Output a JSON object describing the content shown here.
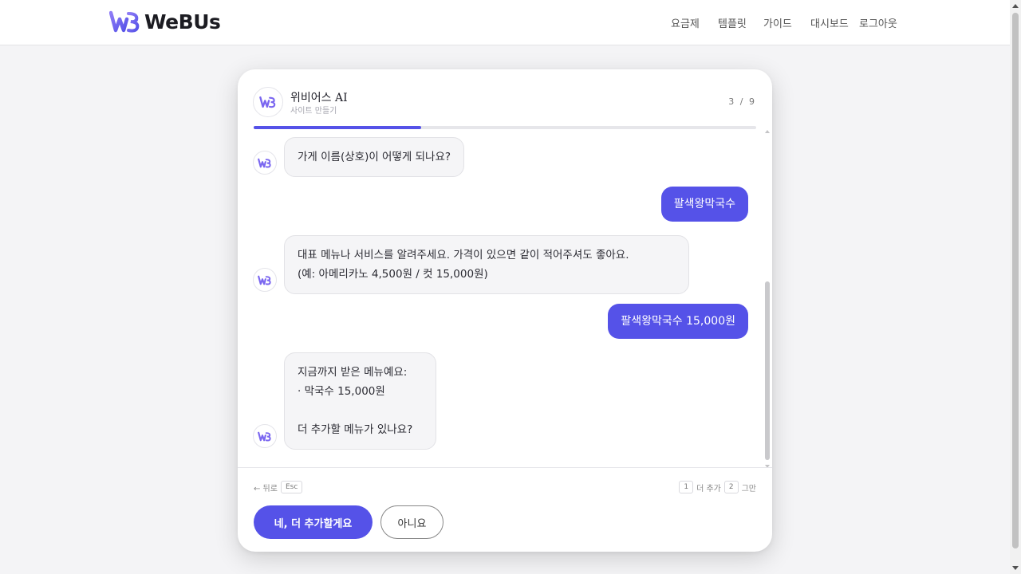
{
  "app": {
    "brand": "WeBUs",
    "brand_color": "#5552e8"
  },
  "nav": {
    "pricing": "요금제",
    "templates": "템플릿",
    "guide": "가이드",
    "dashboard": "대시보드",
    "logout": "로그아웃"
  },
  "chat": {
    "title": "위비어스 AI",
    "subtitle": "사이트 만들기",
    "step": "3 / 9",
    "progress": 0.333,
    "messages": [
      {
        "role": "bot",
        "text": "가게 이름(상호)이 어떻게 되나요?"
      },
      {
        "role": "user",
        "text": "팔색왕막국수"
      },
      {
        "role": "bot",
        "text": "대표 메뉴나 서비스를 알려주세요. 가격이 있으면 같이 적어주셔도 좋아요.\n(예: 아메리카노 4,500원 / 컷 15,000원)"
      },
      {
        "role": "user",
        "text": "팔색왕막국수 15,000원"
      },
      {
        "role": "bot",
        "text": "지금까지 받은 메뉴예요:\n· 막국수 15,000원\n\n더 추가할 메뉴가 있나요?"
      }
    ]
  },
  "footer": {
    "back_label": "← 뒤로",
    "back_key": "Esc",
    "key1": "1",
    "key1_label": "더 추가",
    "key2": "2",
    "key2_label": "그만",
    "primary_button": "네, 더 추가할게요",
    "secondary_button": "아니요"
  }
}
